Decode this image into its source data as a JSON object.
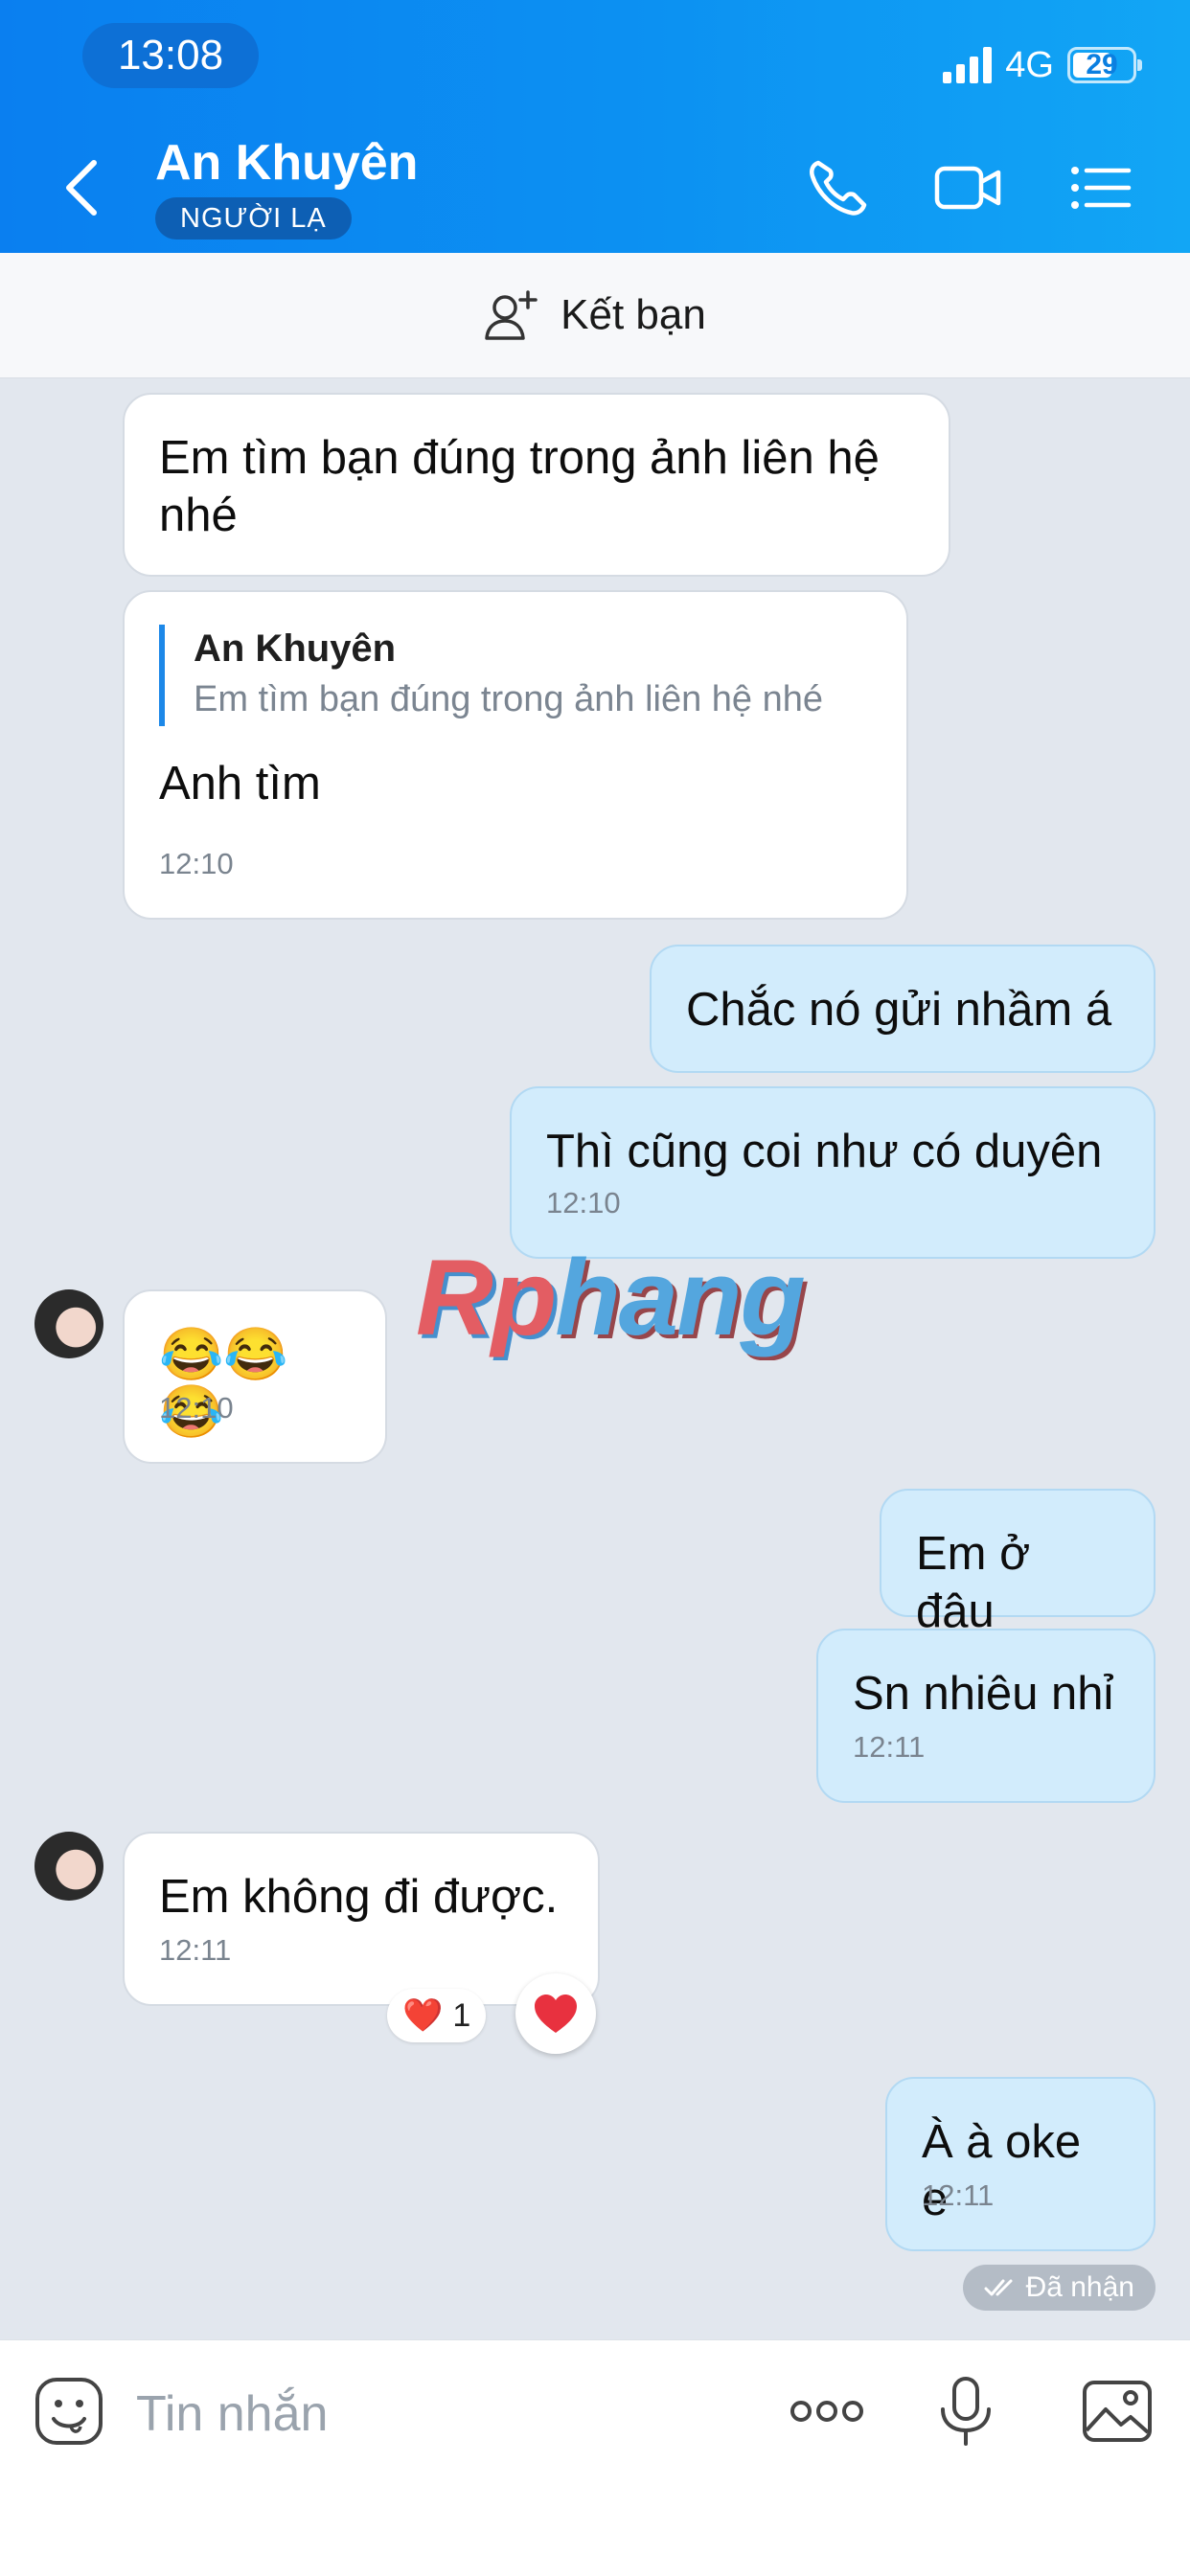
{
  "status_bar": {
    "time": "13:08",
    "network": "4G",
    "battery": "29"
  },
  "header": {
    "contact_name": "An Khuyên",
    "badge": "NGƯỜI LẠ",
    "icons": [
      "back-chevron-icon",
      "phone-icon",
      "video-call-icon",
      "menu-list-icon"
    ]
  },
  "add_friend_bar": {
    "label": "Kết bạn",
    "icon": "add-person-icon"
  },
  "messages": [
    {
      "direction": "in",
      "text": "Em tìm bạn đúng trong ảnh liên hệ nhé"
    },
    {
      "direction": "out",
      "quote_name": "An Khuyên",
      "quote_text": "Em tìm bạn đúng trong ảnh liên hệ nhé",
      "text": "Anh tìm",
      "time": "12:10"
    },
    {
      "direction": "out",
      "text": "Chắc nó gửi nhầm á"
    },
    {
      "direction": "out",
      "text": "Thì cũng coi như có duyên",
      "time": "12:10"
    },
    {
      "direction": "in",
      "text": "😂😂😂",
      "time": "12:10"
    },
    {
      "direction": "out",
      "text": "Em ở đâu"
    },
    {
      "direction": "out",
      "text": "Sn nhiêu nhỉ",
      "time": "12:11"
    },
    {
      "direction": "in",
      "text": "Em không đi được.",
      "time": "12:11",
      "reaction": "❤️",
      "reaction_count": "1"
    },
    {
      "direction": "out",
      "text": "À à oke e",
      "time": "12:11"
    }
  ],
  "receipt": "Đã nhận",
  "watermark": {
    "part1": "Rp",
    "part2": "hang"
  },
  "input_bar": {
    "placeholder": "Tin nhắn"
  },
  "colors": {
    "header": "#0a7ff0",
    "outgoing_bubble": "#d2ecfc",
    "incoming_bubble": "#ffffff",
    "background": "#e2e7ee"
  }
}
